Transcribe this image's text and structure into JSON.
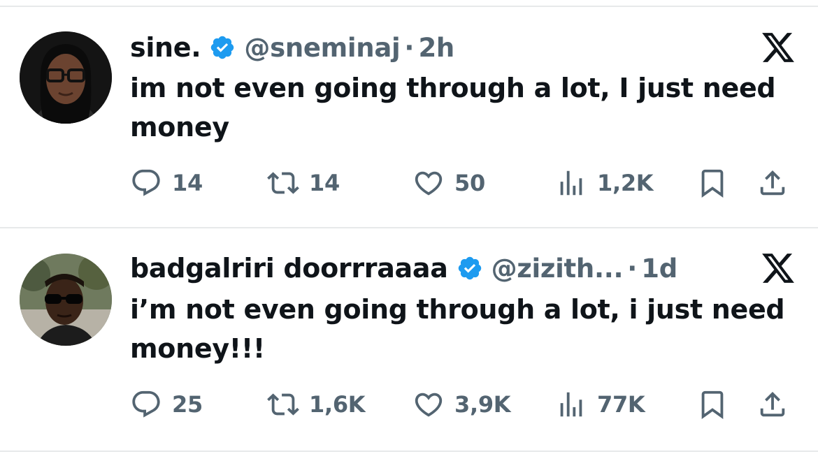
{
  "tweets": [
    {
      "display_name": "sine.",
      "handle": "@sneminaj",
      "separator": "·",
      "time": "2h",
      "text": "im not even going through a lot, I just need money",
      "replies": "14",
      "retweets": "14",
      "likes": "50",
      "views": "1,2K"
    },
    {
      "display_name": "badgalriri doorrraaaa",
      "handle": "@zizith...",
      "separator": "·",
      "time": "1d",
      "text": "i’m not even going through a lot, i just need money!!!",
      "replies": "25",
      "retweets": "1,6K",
      "likes": "3,9K",
      "views": "77K"
    }
  ],
  "colors": {
    "verified": "#1d9bf0",
    "muted": "#536471",
    "text": "#0f1419",
    "divider": "#e7e9ea"
  }
}
